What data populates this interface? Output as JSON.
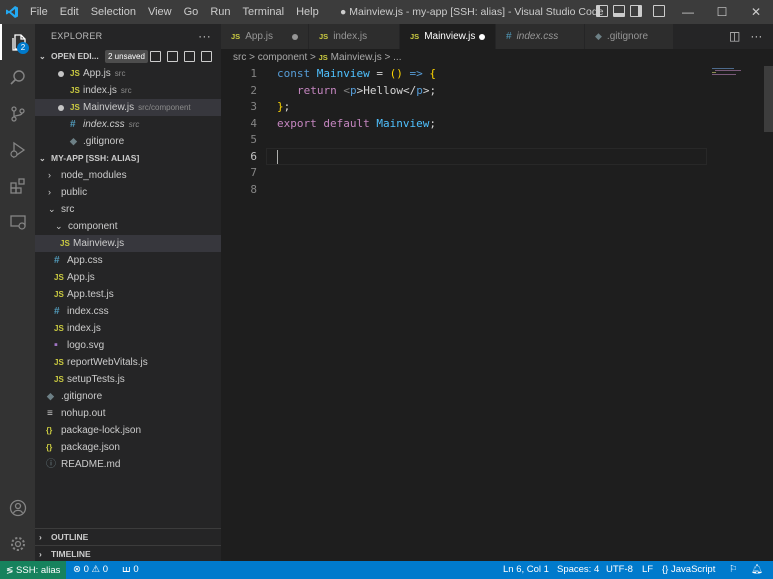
{
  "titlebar": {
    "menu": [
      "File",
      "Edit",
      "Selection",
      "View",
      "Go",
      "Run",
      "Terminal",
      "Help"
    ],
    "window_title": "● Mainview.js - my-app [SSH: alias] - Visual Studio Code",
    "minimize": "—",
    "maximize": "☐",
    "close": "✕"
  },
  "activity_bar": {
    "explorer_badge": "2"
  },
  "sidebar": {
    "title": "EXPLORER",
    "more": "···",
    "open_editors": {
      "header": "OPEN EDI...",
      "unsaved_badge": "2 unsaved",
      "items": [
        {
          "icon": "JS",
          "name": "App.js",
          "path": "src",
          "modified": true
        },
        {
          "icon": "JS",
          "name": "index.js",
          "path": "src",
          "modified": false
        },
        {
          "icon": "JS",
          "name": "Mainview.js",
          "path": "src/component",
          "modified": true
        },
        {
          "icon": "#",
          "name": "index.css",
          "path": "src",
          "modified": false
        },
        {
          "icon": "◆",
          "name": ".gitignore",
          "path": "",
          "modified": false
        }
      ]
    },
    "project": {
      "header": "MY-APP [SSH: ALIAS]",
      "tree": [
        {
          "label": "node_modules",
          "icon": "›"
        },
        {
          "label": "public",
          "icon": "›"
        },
        {
          "label": "src",
          "icon": "⌄"
        },
        {
          "label": "component",
          "icon": "⌄"
        },
        {
          "label": "Mainview.js",
          "icon": "JS"
        },
        {
          "label": "App.css",
          "icon": "#"
        },
        {
          "label": "App.js",
          "icon": "JS"
        },
        {
          "label": "App.test.js",
          "icon": "JS"
        },
        {
          "label": "index.css",
          "icon": "#"
        },
        {
          "label": "index.js",
          "icon": "JS"
        },
        {
          "label": "logo.svg",
          "icon": "▪"
        },
        {
          "label": "reportWebVitals.js",
          "icon": "JS"
        },
        {
          "label": "setupTests.js",
          "icon": "JS"
        },
        {
          "label": ".gitignore",
          "icon": "◆"
        },
        {
          "label": "nohup.out",
          "icon": "≡"
        },
        {
          "label": "package-lock.json",
          "icon": "{}"
        },
        {
          "label": "package.json",
          "icon": "{}"
        },
        {
          "label": "README.md",
          "icon": "ⓘ"
        }
      ]
    },
    "outline": "OUTLINE",
    "timeline": "TIMELINE"
  },
  "tabs": [
    {
      "icon": "JS",
      "label": "App.js",
      "dot": true
    },
    {
      "icon": "JS",
      "label": "index.js",
      "dot": false
    },
    {
      "icon": "JS",
      "label": "Mainview.js",
      "dot": true
    },
    {
      "icon": "#",
      "label": "index.css",
      "dot": false
    },
    {
      "icon": "◆",
      "label": ".gitignore",
      "dot": false
    }
  ],
  "breadcrumb": {
    "part1": "src",
    "sep": ">",
    "part2": "component",
    "file_icon": "JS",
    "file": "Mainview.js",
    "tail": "..."
  },
  "editor": {
    "line_numbers": [
      "1",
      "2",
      "3",
      "4",
      "5",
      "6",
      "7",
      "8"
    ],
    "current_line": 6,
    "lines": [
      [
        "const",
        " ",
        "Mainview",
        " = ",
        "()",
        " => ",
        "{"
      ],
      [
        "return",
        " ",
        "<",
        "p",
        ">Hellow</",
        "p",
        ">;"
      ],
      [
        "}",
        ";"
      ],
      [
        "export",
        " ",
        "default",
        " ",
        "Mainview",
        ";"
      ]
    ]
  },
  "statusbar": {
    "remote": "SSH: alias",
    "errors": "0",
    "warnings": "0",
    "ports": "0",
    "position": "Ln 6, Col 1",
    "spaces": "Spaces: 4",
    "encoding": "UTF-8",
    "eol": "LF",
    "language": "JavaScript"
  }
}
